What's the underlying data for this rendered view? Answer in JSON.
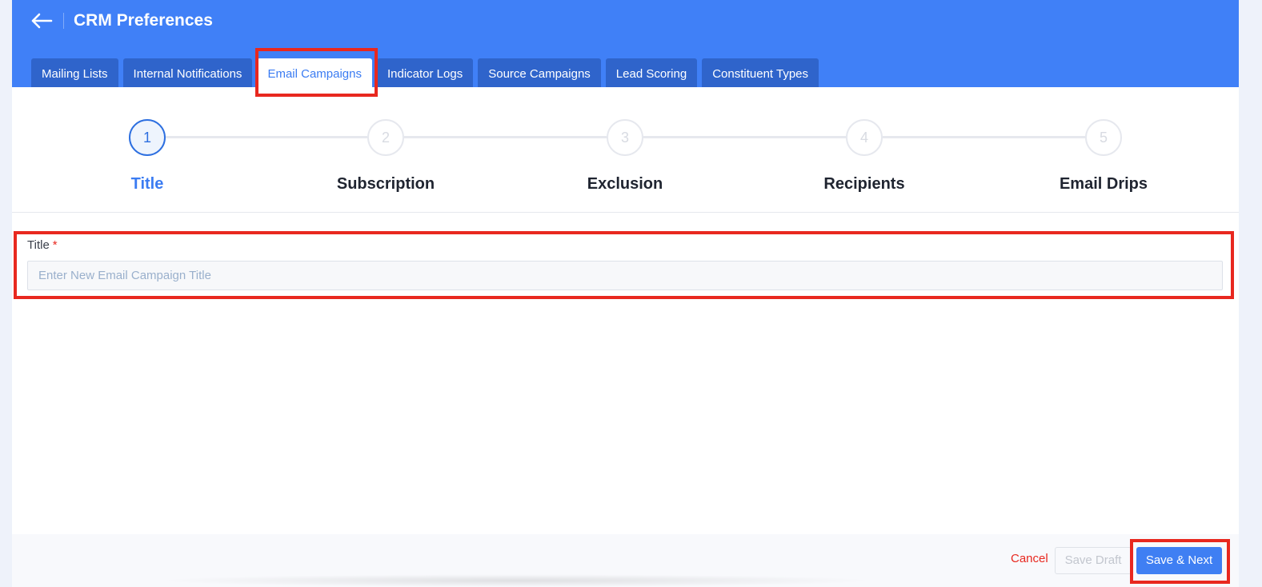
{
  "header": {
    "title": "CRM Preferences",
    "back_icon": "arrow-left-icon"
  },
  "tabs": [
    {
      "label": "Mailing Lists",
      "active": false
    },
    {
      "label": "Internal Notifications",
      "active": false
    },
    {
      "label": "Email Campaigns",
      "active": true
    },
    {
      "label": "Indicator Logs",
      "active": false
    },
    {
      "label": "Source Campaigns",
      "active": false
    },
    {
      "label": "Lead Scoring",
      "active": false
    },
    {
      "label": "Constituent Types",
      "active": false
    }
  ],
  "stepper": {
    "current_step": 1,
    "steps": [
      {
        "number": "1",
        "label": "Title"
      },
      {
        "number": "2",
        "label": "Subscription"
      },
      {
        "number": "3",
        "label": "Exclusion"
      },
      {
        "number": "4",
        "label": "Recipients"
      },
      {
        "number": "5",
        "label": "Email Drips"
      }
    ]
  },
  "form": {
    "title_label": "Title",
    "required_marker": "*",
    "title_value": "",
    "title_placeholder": "Enter New Email Campaign Title"
  },
  "footer": {
    "cancel_label": "Cancel",
    "save_draft_label": "Save Draft",
    "save_next_label": "Save & Next"
  },
  "colors": {
    "header_bg": "#4080f7",
    "tab_bg": "#2f64cb",
    "accent": "#3b7cf2",
    "highlight": "#e8281f",
    "danger": "#e8281f"
  }
}
